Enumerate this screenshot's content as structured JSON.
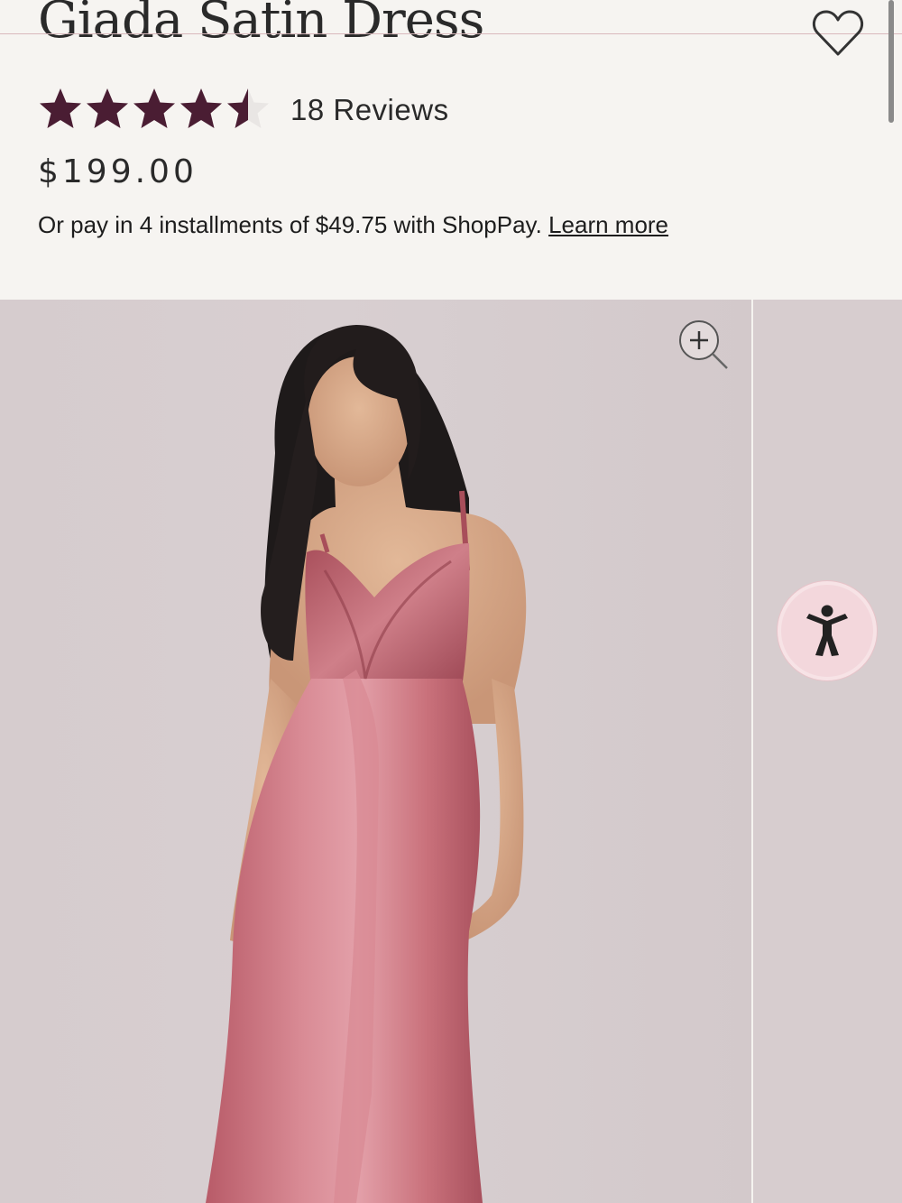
{
  "product": {
    "title": "Giada Satin Dress",
    "rating": 4.5,
    "rating_max": 5,
    "review_count_label": "18 Reviews",
    "price": "$199.00",
    "installments_text": "Or pay in 4 installments of $49.75 with ShopPay.",
    "learn_more_label": "Learn more"
  },
  "icons": {
    "favorite": "heart-icon",
    "zoom": "zoom-in-icon",
    "accessibility": "accessibility-icon",
    "star": "star-icon"
  },
  "colors": {
    "star_filled": "#4a1d33",
    "star_empty": "#e9e6e4",
    "dress": "#c9717b",
    "accessibility_bg": "#f3d7dc"
  }
}
